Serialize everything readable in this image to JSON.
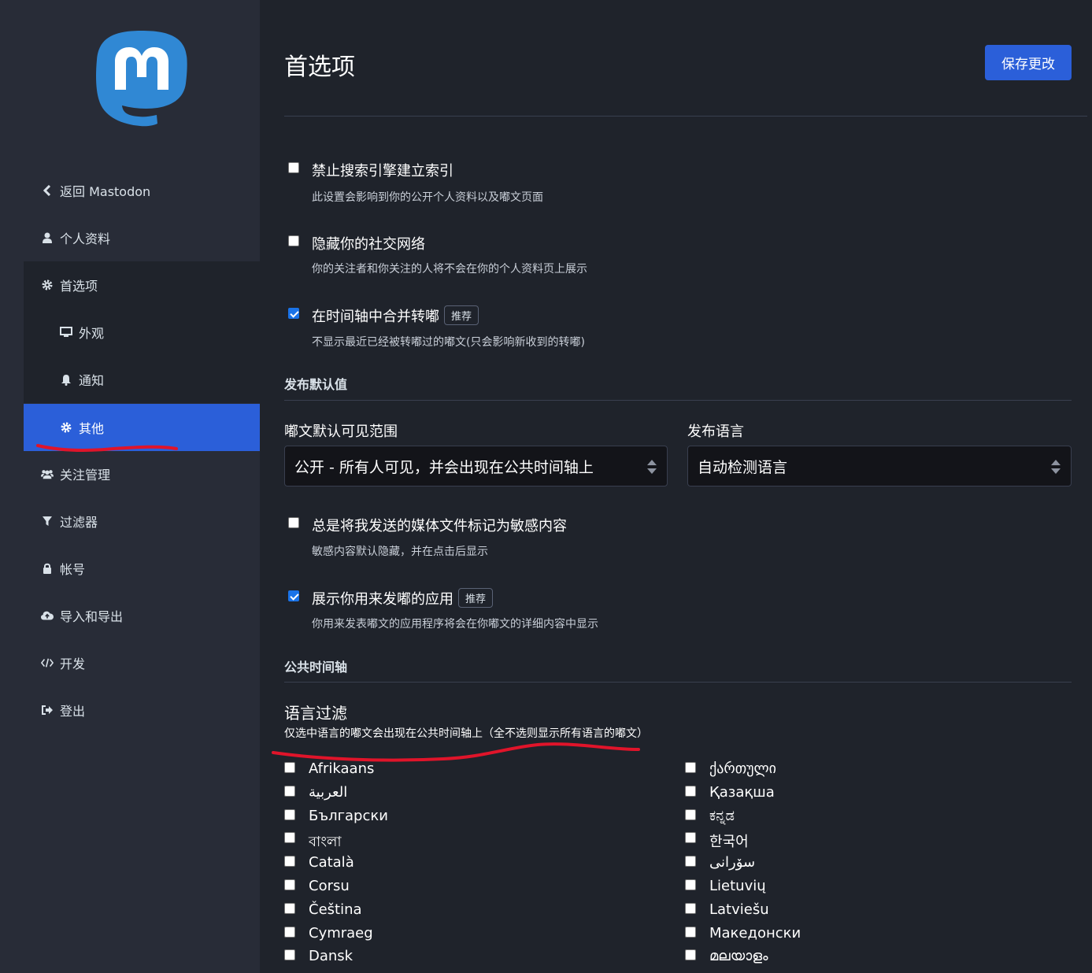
{
  "sidebar": {
    "logo": "mastodon-logo",
    "items": [
      {
        "label": "返回 Mastodon",
        "icon": "chevron-left-icon"
      },
      {
        "label": "个人资料",
        "icon": "user-icon"
      },
      {
        "label": "首选项",
        "icon": "gear-icon"
      },
      {
        "label": "外观",
        "icon": "desktop-icon"
      },
      {
        "label": "通知",
        "icon": "bell-icon"
      },
      {
        "label": "其他",
        "icon": "gear-icon"
      },
      {
        "label": "关注管理",
        "icon": "users-icon"
      },
      {
        "label": "过滤器",
        "icon": "filter-icon"
      },
      {
        "label": "帐号",
        "icon": "lock-icon"
      },
      {
        "label": "导入和导出",
        "icon": "cloud-upload-icon"
      },
      {
        "label": "开发",
        "icon": "code-icon"
      },
      {
        "label": "登出",
        "icon": "sign-out-icon"
      }
    ]
  },
  "header": {
    "title": "首选项",
    "save_label": "保存更改"
  },
  "settings": {
    "noindex": {
      "label": "禁止搜索引擎建立索引",
      "hint": "此设置会影响到你的公开个人资料以及嘟文页面",
      "checked": false
    },
    "hide_network": {
      "label": "隐藏你的社交网络",
      "hint": "你的关注者和你关注的人将不会在你的个人资料页上展示",
      "checked": false
    },
    "aggregate_reblogs": {
      "label": "在时间轴中合并转嘟",
      "badge": "推荐",
      "hint": "不显示最近已经被转嘟过的嘟文(只会影响新收到的转嘟)",
      "checked": true
    },
    "posting_defaults_title": "发布默认值",
    "visibility": {
      "label": "嘟文默认可见范围",
      "value": "公开 - 所有人可见，并会出现在公共时间轴上"
    },
    "language": {
      "label": "发布语言",
      "value": "自动检测语言"
    },
    "sensitive": {
      "label": "总是将我发送的媒体文件标记为敏感内容",
      "hint": "敏感内容默认隐藏，并在点击后显示",
      "checked": false
    },
    "show_application": {
      "label": "展示你用来发嘟的应用",
      "badge": "推荐",
      "hint": "你用来发表嘟文的应用程序将会在你嘟文的详细内容中显示",
      "checked": true
    },
    "public_timelines_title": "公共时间轴",
    "language_filter": {
      "title": "语言过滤",
      "hint": "仅选中语言的嘟文会出现在公共时间轴上（全不选则显示所有语言的嘟文）",
      "left": [
        "Afrikaans",
        "العربية",
        "Български",
        "বাংলা",
        "Català",
        "Corsu",
        "Čeština",
        "Cymraeg",
        "Dansk"
      ],
      "right": [
        "ქართული",
        "Қазақша",
        "ಕನ್ನಡ",
        "한국어",
        "سۆرانی",
        "Lietuvių",
        "Latviešu",
        "Македонски",
        "മലയാളം"
      ]
    }
  },
  "colors": {
    "accent": "#2b5fd9",
    "sidebar": "#282c37",
    "background": "#1f232b",
    "annotation": "#e0142a"
  }
}
